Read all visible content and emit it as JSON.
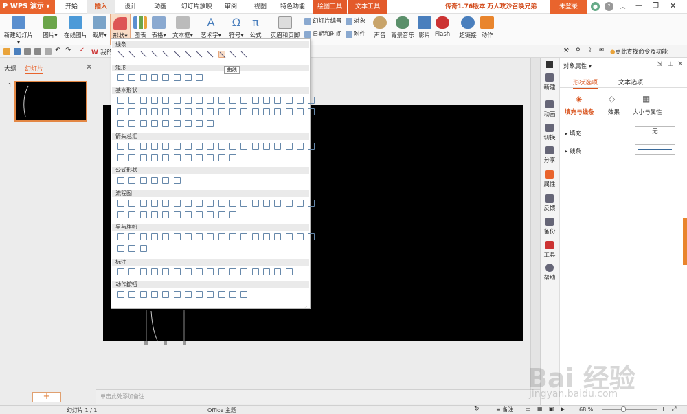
{
  "app": {
    "name": "WPS 演示"
  },
  "menu_tabs": [
    "开始",
    "插入",
    "设计",
    "动画",
    "幻灯片放映",
    "审阅",
    "视图",
    "特色功能",
    "绘图工具",
    "文本工具"
  ],
  "active_tab": "插入",
  "promo_text": "传奇1.76版本 万人攻沙召唤兄弟",
  "login_label": "未登录",
  "ribbon": {
    "new_slide": "新建幻灯片",
    "picture": "图片",
    "online_picture": "在线图片",
    "screenshot": "截屏",
    "shapes": "形状",
    "chart": "图表",
    "table": "表格",
    "textbox": "文本框",
    "wordart": "艺术字",
    "symbol": "符号",
    "formula": "公式",
    "header_footer": "页眉和页脚",
    "slide_number": "幻灯片编号",
    "object": "对象",
    "date_time": "日期和时间",
    "attachment": "附件",
    "sound": "声音",
    "bg_music": "背景音乐",
    "movie": "影片",
    "flash": "Flash",
    "hyperlink": "超链接",
    "action": "动作"
  },
  "quick_toolbar": {
    "find_cmd": "点此查找命令及功能",
    "wordart_label": "我的"
  },
  "left_pane": {
    "tab_outline": "大纲",
    "tab_slides": "幻灯片",
    "slide_num": "1",
    "add": "+"
  },
  "notes_placeholder": "单击此处添加备注",
  "shapes_dropdown": {
    "sections": [
      "线条",
      "矩形",
      "基本形状",
      "箭头总汇",
      "公式形状",
      "流程图",
      "星与旗帜",
      "标注",
      "动作按钮"
    ],
    "tooltip": "曲线"
  },
  "right_bar": [
    "新建",
    "动画",
    "切换",
    "分享",
    "属性",
    "反馈",
    "备份",
    "工具",
    "帮助"
  ],
  "properties": {
    "title": "对象属性",
    "tab_shape": "形状选项",
    "tab_text": "文本选项",
    "sub_fill_line": "填充与线条",
    "sub_effect": "效果",
    "sub_size": "大小与属性",
    "fill_label": "填充",
    "fill_value": "无",
    "line_label": "线条"
  },
  "status": {
    "slide": "幻灯片 1 / 1",
    "theme": "Office 主题",
    "notes": "备注",
    "zoom": "68 %"
  },
  "watermark": {
    "brand": "Bai 经验",
    "url": "jingyan.baidu.com"
  },
  "colors": {
    "accent": "#e9642d",
    "context_tab": "#e35a2a",
    "shape_stroke": "#6688aa"
  }
}
